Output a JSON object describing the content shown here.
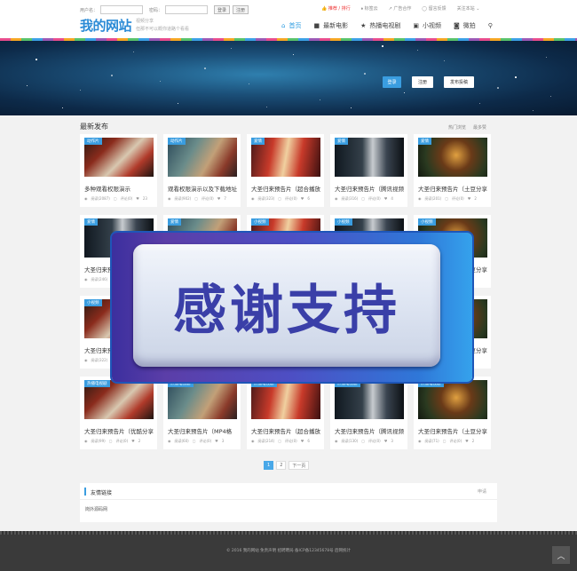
{
  "header": {
    "username_label": "用户名：",
    "password_label": "密码：",
    "login_btn": "登录",
    "register_btn": "注册",
    "logo": "我的网站",
    "slogan_line1": "视频分享",
    "slogan_line2": "但那不可以概你道路个看看",
    "top_links": [
      {
        "label": "推荐 / 排行",
        "icon": "thumb-up-icon"
      },
      {
        "label": "标签云",
        "icon": "tag-icon"
      },
      {
        "label": "广告合作",
        "icon": "chart-icon"
      },
      {
        "label": "留言反馈",
        "icon": "chat-icon"
      },
      {
        "label": "关注本站 ⌄",
        "icon": ""
      }
    ],
    "nav": [
      {
        "label": "首页",
        "icon": "home-icon",
        "active": true
      },
      {
        "label": "最新电影",
        "icon": "video-camera-icon",
        "active": false
      },
      {
        "label": "热播电视剧",
        "icon": "star-icon",
        "active": false
      },
      {
        "label": "小视频",
        "icon": "play-square-icon",
        "active": false
      },
      {
        "label": "微拍",
        "icon": "camera-icon",
        "active": false
      }
    ]
  },
  "banner": {
    "login_btn": "登录",
    "register_btn": "注册",
    "post_btn": "发布投稿"
  },
  "section": {
    "title": "最新发布",
    "tabs": [
      "热门浏览",
      "最多赞"
    ]
  },
  "cards": [
    {
      "tag": "动作片",
      "tag_color": "#3a9de0",
      "title": "多种观看权限演示",
      "views": "阅读(2087)",
      "comments": "评论(0)",
      "likes": "23",
      "img": "a"
    },
    {
      "tag": "动作片",
      "tag_color": "#3a9de0",
      "title": "观看权限演示以及下载地址",
      "views": "阅读(902)",
      "comments": "评论(0)",
      "likes": "7",
      "img": "b"
    },
    {
      "tag": "爱情",
      "tag_color": "#3a9de0",
      "title": "大圣归来预告片（超合播放",
      "views": "阅读(323)",
      "comments": "评论(0)",
      "likes": "6",
      "img": "c"
    },
    {
      "tag": "爱情",
      "tag_color": "#3a9de0",
      "title": "大圣归来预告片（腾讯视频",
      "views": "阅读(316)",
      "comments": "评论(0)",
      "likes": "4",
      "img": "d"
    },
    {
      "tag": "爱情",
      "tag_color": "#3a9de0",
      "title": "大圣归来预告片（土豆分享",
      "views": "阅读(201)",
      "comments": "评论(0)",
      "likes": "2",
      "img": "e"
    },
    {
      "tag": "爱情",
      "tag_color": "#3a9de0",
      "title": "大圣归来预",
      "views": "阅读(246)",
      "comments": "",
      "likes": "",
      "img": "d"
    },
    {
      "tag": "爱情",
      "tag_color": "#3a9de0",
      "title": "",
      "views": "",
      "comments": "",
      "likes": "",
      "img": "b"
    },
    {
      "tag": "小视频",
      "tag_color": "#3a9de0",
      "title": "",
      "views": "",
      "comments": "",
      "likes": "",
      "img": "c"
    },
    {
      "tag": "小视频",
      "tag_color": "#3a9de0",
      "title": "",
      "views": "",
      "comments": "",
      "likes": "",
      "img": "d"
    },
    {
      "tag": "小视频",
      "tag_color": "#3a9de0",
      "title": "大圣归来预告片（土豆分享",
      "views": "",
      "comments": "",
      "likes": "2",
      "img": "e"
    },
    {
      "tag": "小视频",
      "tag_color": "#3a9de0",
      "title": "大圣归来预",
      "views": "阅读(322)",
      "comments": "",
      "likes": "",
      "img": "a"
    },
    {
      "tag": "",
      "tag_color": "#3a9de0",
      "title": "",
      "views": "",
      "comments": "",
      "likes": "",
      "img": "b"
    },
    {
      "tag": "",
      "tag_color": "#3a9de0",
      "title": "",
      "views": "",
      "comments": "",
      "likes": "",
      "img": "c"
    },
    {
      "tag": "",
      "tag_color": "#3a9de0",
      "title": "",
      "views": "",
      "comments": "",
      "likes": "",
      "img": "d"
    },
    {
      "tag": "",
      "tag_color": "#3a9de0",
      "title": "大圣归来预告片（土豆分享",
      "views": "",
      "comments": "",
      "likes": "1",
      "img": "e"
    },
    {
      "tag": "热播电视剧",
      "tag_color": "#3a9de0",
      "title": "大圣归来预告片（优酷分享",
      "views": "阅读(99)",
      "comments": "评论(0)",
      "likes": "2",
      "img": "a"
    },
    {
      "tag": "热播电视剧",
      "tag_color": "#3a9de0",
      "title": "大圣归来预告片（MP4格",
      "views": "阅读(60)",
      "comments": "评论(0)",
      "likes": "3",
      "img": "b"
    },
    {
      "tag": "热播电视剧",
      "tag_color": "#3a9de0",
      "title": "大圣归来预告片（超合播放",
      "views": "阅读(214)",
      "comments": "评论(0)",
      "likes": "6",
      "img": "c"
    },
    {
      "tag": "热播电视剧",
      "tag_color": "#3a9de0",
      "title": "大圣归来预告片（腾讯视频",
      "views": "阅读(130)",
      "comments": "评论(0)",
      "likes": "3",
      "img": "d"
    },
    {
      "tag": "热播电视剧",
      "tag_color": "#3a9de0",
      "title": "大圣归来预告片（土豆分享",
      "views": "阅读(71)",
      "comments": "评论(0)",
      "likes": "2",
      "img": "e"
    }
  ],
  "overlay_text": "感谢支持",
  "pager": {
    "pages": [
      "1",
      "2"
    ],
    "next": "下一页",
    "current": "1"
  },
  "links": {
    "title": "友情链接",
    "apply": "申请",
    "items": [
      "岗外源码网"
    ]
  },
  "footer": {
    "text": "© 2016  我的网站  免责声明  招聘聘局  备ICP备12345678号  后网统计"
  },
  "colors": {
    "accent": "#3a9de0",
    "logo": "#2b8bd6",
    "overlay_text": "#3a3fa8"
  }
}
